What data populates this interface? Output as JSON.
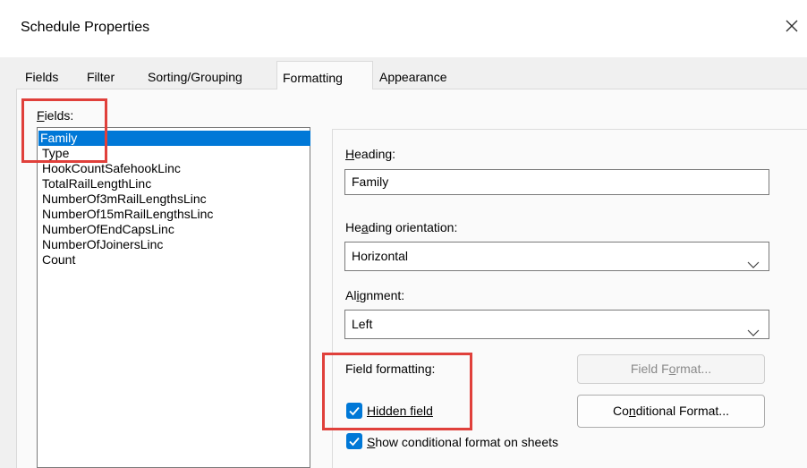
{
  "window": {
    "title": "Schedule Properties"
  },
  "tabs": [
    {
      "label": "Fields"
    },
    {
      "label": "Filter"
    },
    {
      "label": "Sorting/Grouping"
    },
    {
      "label": "Formatting",
      "active": true
    },
    {
      "label": "Appearance"
    }
  ],
  "fields": {
    "label_prefix": "F",
    "label_rest": "ields:",
    "items": [
      "Family",
      "Type",
      "HookCountSafehookLinc",
      "TotalRailLengthLinc",
      "NumberOf3mRailLengthsLinc",
      "NumberOf15mRailLengthsLinc",
      "NumberOfEndCapsLinc",
      "NumberOfJoinersLinc",
      "Count"
    ],
    "selected": "Family"
  },
  "heading": {
    "label_prefix": "H",
    "label_rest": "eading:",
    "value": "Family"
  },
  "heading_orientation": {
    "label_pre": "He",
    "label_u": "a",
    "label_rest": "ding orientation:",
    "value": "Horizontal"
  },
  "alignment": {
    "label_pre": "Al",
    "label_u": "i",
    "label_rest": "gnment:",
    "value": "Left"
  },
  "field_formatting": {
    "label": "Field formatting:",
    "field_format_button": {
      "pre": "Field F",
      "u": "o",
      "rest": "rmat..."
    },
    "conditional_format_button": {
      "pre": "Co",
      "u": "n",
      "rest": "ditional Format..."
    },
    "hidden_field": {
      "label": "Hidden field",
      "checked": true
    },
    "show_conditional": {
      "u": "S",
      "rest": "how conditional format on sheets",
      "checked": true
    }
  },
  "colors": {
    "accent": "#0078d7",
    "highlight_box": "#e0403b"
  }
}
